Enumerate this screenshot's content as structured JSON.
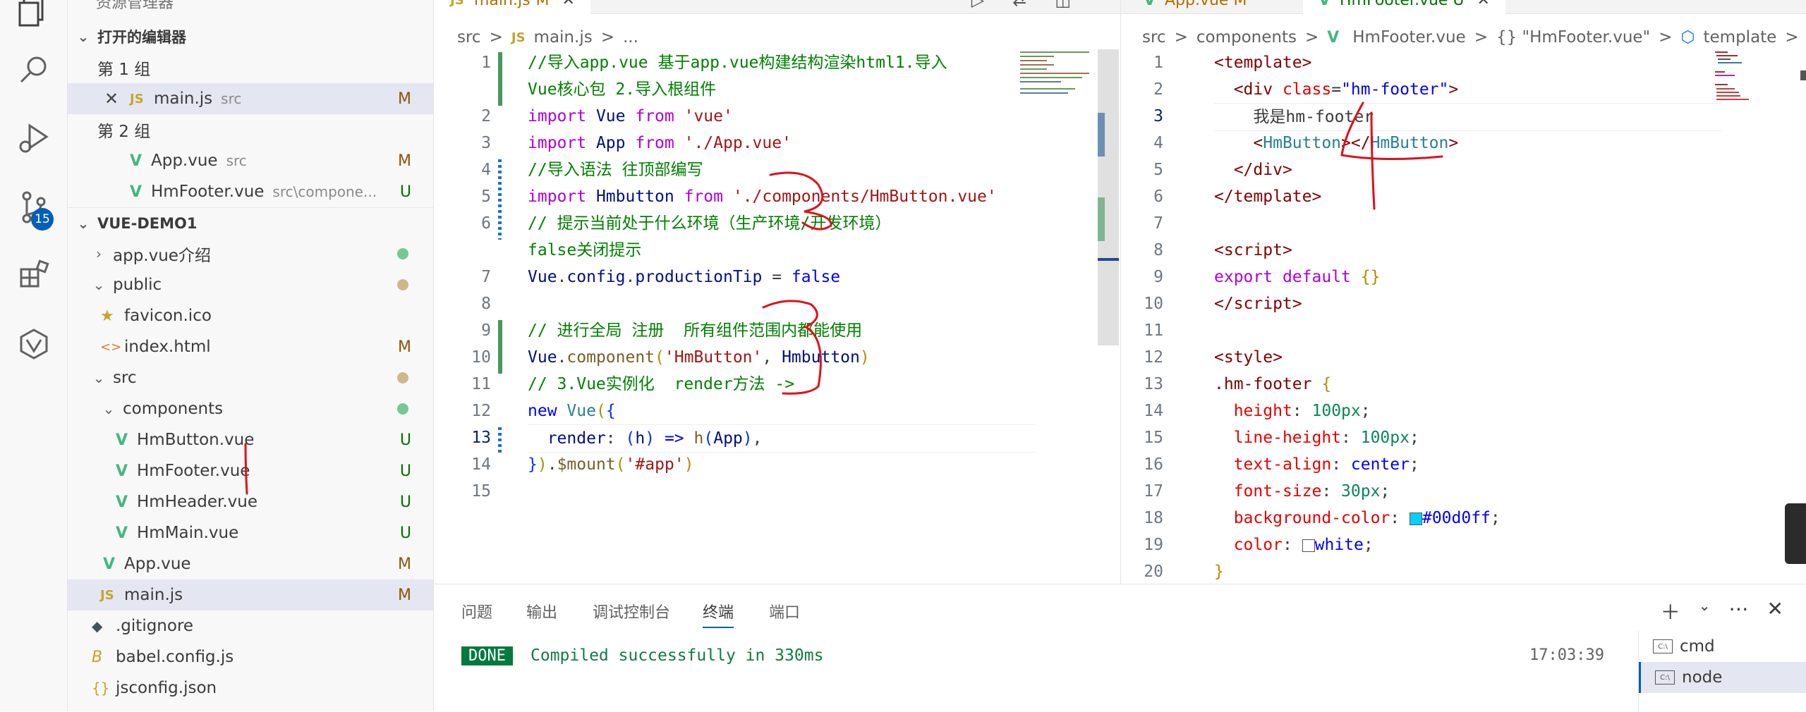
{
  "sidebar": {
    "title": "资源管理器",
    "open_editors": "打开的编辑器",
    "group1": "第 1 组",
    "group2": "第 2 组",
    "open_files": [
      {
        "name": "main.js",
        "path": "src",
        "status": "M"
      },
      {
        "name": "App.vue",
        "path": "src",
        "status": "M"
      },
      {
        "name": "HmFooter.vue",
        "path": "src\\compone...",
        "status": "U"
      }
    ],
    "project": "VUE-DEMO1",
    "tree": [
      {
        "name": "app.vue介绍",
        "status": ""
      },
      {
        "name": "public",
        "status": ""
      },
      {
        "name": "favicon.ico",
        "status": ""
      },
      {
        "name": "index.html",
        "status": "M"
      },
      {
        "name": "src",
        "status": ""
      },
      {
        "name": "components",
        "status": ""
      },
      {
        "name": "HmButton.vue",
        "status": "U"
      },
      {
        "name": "HmFooter.vue",
        "status": "U"
      },
      {
        "name": "HmHeader.vue",
        "status": "U"
      },
      {
        "name": "HmMain.vue",
        "status": "U"
      },
      {
        "name": "App.vue",
        "status": "M"
      },
      {
        "name": "main.js",
        "status": "M"
      },
      {
        "name": ".gitignore",
        "status": ""
      },
      {
        "name": "babel.config.js",
        "status": ""
      },
      {
        "name": "jsconfig.json",
        "status": ""
      }
    ],
    "scm_badge": "15"
  },
  "editor1": {
    "tab": "main.js",
    "tab_status": "M",
    "breadcrumb": [
      "src",
      ">",
      "JS",
      "main.js",
      ">",
      "..."
    ],
    "line_numbers": [
      "1",
      "2",
      "3",
      "4",
      "5",
      "6",
      "7",
      "8",
      "9",
      "10",
      "11",
      "12",
      "13",
      "14",
      "15"
    ]
  },
  "editor2": {
    "tabs": [
      "App.vue M",
      "HmFooter.vue U"
    ],
    "breadcrumb": [
      "src",
      ">",
      "components",
      ">",
      "HmFooter.vue",
      ">",
      "{} \"HmFooter.vue\"",
      ">",
      "template",
      ">"
    ],
    "line_numbers": [
      "1",
      "2",
      "3",
      "4",
      "5",
      "6",
      "7",
      "8",
      "9",
      "10",
      "11",
      "12",
      "13",
      "14",
      "15",
      "16",
      "17",
      "18",
      "19",
      "20"
    ],
    "color_swatch": "#00d0ff"
  },
  "panel": {
    "tabs": [
      "问题",
      "输出",
      "调试控制台",
      "终端",
      "端口"
    ],
    "active_tab": "终端",
    "done_label": "DONE",
    "message": "Compiled successfully in 330ms",
    "time": "17:03:39",
    "terminals": [
      "cmd",
      "node"
    ]
  }
}
